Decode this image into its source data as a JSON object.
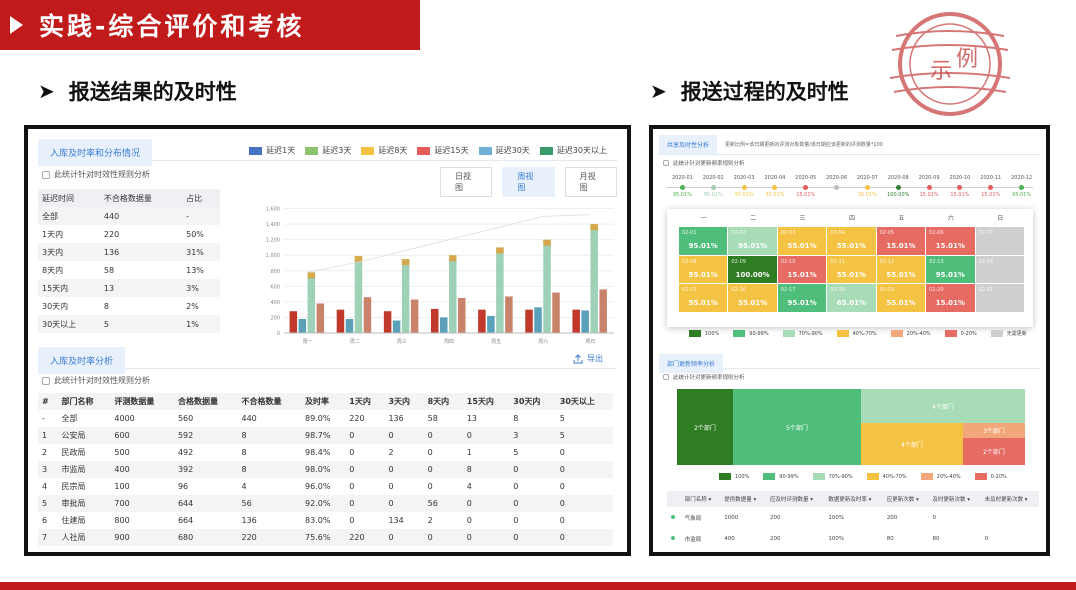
{
  "banner": {
    "title": "实践-综合评价和考核"
  },
  "left_heading": "报送结果的及时性",
  "right_heading": "报送过程的及时性",
  "stamp": {
    "text_left": "示",
    "text_right": "例"
  },
  "colors": {
    "accent_red": "#c11a1a",
    "link_blue": "#3a7bd5"
  },
  "left_panel": {
    "tab1": "入库及时率和分布情况",
    "checkbox1": "此统计针对时效性规则分析",
    "views": [
      "日视图",
      "周视图",
      "月视图"
    ],
    "legend": [
      {
        "label": "延迟1天",
        "color": "#4472c4"
      },
      {
        "label": "延迟3天",
        "color": "#8dc26f"
      },
      {
        "label": "延迟8天",
        "color": "#f5c343"
      },
      {
        "label": "延迟15天",
        "color": "#e45c5c"
      },
      {
        "label": "延迟30天",
        "color": "#6fb1d6"
      },
      {
        "label": "延迟30天以上",
        "color": "#3a9b6b"
      }
    ],
    "dist_table": {
      "headers": [
        "延迟时间",
        "不合格数据量",
        "占比"
      ],
      "rows": [
        [
          "全部",
          "440",
          "-"
        ],
        [
          "1天内",
          "220",
          "50%"
        ],
        [
          "3天内",
          "136",
          "31%"
        ],
        [
          "8天内",
          "58",
          "13%"
        ],
        [
          "15天内",
          "13",
          "3%"
        ],
        [
          "30天内",
          "8",
          "2%"
        ],
        [
          "30天以上",
          "5",
          "1%"
        ]
      ]
    },
    "tab2": "入库及时率分析",
    "export": "导出",
    "checkbox2": "此统计针对时效性规则分析",
    "dept_table": {
      "headers": [
        "#",
        "部门名称",
        "评测数据量",
        "合格数据量",
        "不合格数量",
        "及时率",
        "1天内",
        "3天内",
        "8天内",
        "15天内",
        "30天内",
        "30天以上"
      ],
      "rows": [
        [
          "-",
          "全部",
          "4000",
          "560",
          "440",
          "89.0%",
          "220",
          "136",
          "58",
          "13",
          "8",
          "5"
        ],
        [
          "1",
          "公安局",
          "600",
          "592",
          "8",
          "98.7%",
          "0",
          "0",
          "0",
          "0",
          "3",
          "5"
        ],
        [
          "2",
          "民政局",
          "500",
          "492",
          "8",
          "98.4%",
          "0",
          "2",
          "0",
          "1",
          "5",
          "0"
        ],
        [
          "3",
          "市监局",
          "400",
          "392",
          "8",
          "98.0%",
          "0",
          "0",
          "0",
          "8",
          "0",
          "0"
        ],
        [
          "4",
          "民宗局",
          "100",
          "96",
          "4",
          "96.0%",
          "0",
          "0",
          "0",
          "4",
          "0",
          "0"
        ],
        [
          "5",
          "审批局",
          "700",
          "644",
          "56",
          "92.0%",
          "0",
          "0",
          "56",
          "0",
          "0",
          "0"
        ],
        [
          "6",
          "住建局",
          "800",
          "664",
          "136",
          "83.0%",
          "0",
          "134",
          "2",
          "0",
          "0",
          "0"
        ],
        [
          "7",
          "人社局",
          "900",
          "680",
          "220",
          "75.6%",
          "220",
          "0",
          "0",
          "0",
          "0",
          "0"
        ]
      ]
    }
  },
  "chart_data": {
    "type": "bar",
    "categories": [
      "周一",
      "周二",
      "周三",
      "周四",
      "周五",
      "周六",
      "周日"
    ],
    "ylim": [
      0,
      1800
    ],
    "yticks": [
      "0",
      "200",
      "400",
      "600",
      "800",
      "1,000",
      "1,200",
      "1,400",
      "1,600"
    ],
    "series": [
      {
        "values": [
          280,
          300,
          280,
          310,
          300,
          300,
          300
        ],
        "color": "#c0392b"
      },
      {
        "values": [
          180,
          180,
          160,
          200,
          220,
          330,
          290
        ],
        "color": "#5aa0b8"
      },
      {
        "values": [
          780,
          990,
          950,
          1000,
          1100,
          1200,
          1400
        ],
        "color": "#9fd1b7"
      },
      {
        "values": [
          380,
          460,
          430,
          450,
          470,
          520,
          560
        ],
        "color": "#c8836a"
      }
    ],
    "trend": [
      780,
      900,
      1050,
      1200,
      1350,
      1500,
      1520
    ]
  },
  "right_panel": {
    "tab1": "共享及时性分析",
    "tab1_desc": "更新比例=该日期更新的评测对象数量/该日期应该更新的评测数量*100",
    "checkbox1": "此统计针对更新频率规则分析",
    "timeline": [
      {
        "m": "2020-01",
        "v": "95.01%",
        "c": "#4caf50"
      },
      {
        "m": "2020-02",
        "v": "95.01%",
        "c": "#9fcfb0"
      },
      {
        "m": "2020-03",
        "v": "35.01%",
        "c": "#f5c343"
      },
      {
        "m": "2020-04",
        "v": "35.01%",
        "c": "#f5c343"
      },
      {
        "m": "2020-05",
        "v": "15.01%",
        "c": "#e45c5c"
      },
      {
        "m": "2020-06",
        "v": "",
        "c": "#bbb"
      },
      {
        "m": "2020-07",
        "v": "35.01%",
        "c": "#f5c343"
      },
      {
        "m": "2020-08",
        "v": "100.00%",
        "c": "#2e7d32"
      },
      {
        "m": "2020-09",
        "v": "15.01%",
        "c": "#e45c5c"
      },
      {
        "m": "2020-10",
        "v": "15.01%",
        "c": "#e45c5c"
      },
      {
        "m": "2020-11",
        "v": "15.01%",
        "c": "#e45c5c"
      },
      {
        "m": "2020-12",
        "v": "95.01%",
        "c": "#4caf50"
      }
    ],
    "weekdays": [
      "一",
      "二",
      "三",
      "四",
      "五",
      "六",
      "日"
    ],
    "calendar": [
      [
        {
          "d": "02-01",
          "p": "95.01%",
          "c": "#4fbe7a"
        },
        {
          "d": "02-02",
          "p": "95.01%",
          "c": "#a8dcb7"
        },
        {
          "d": "02-03",
          "p": "55.01%",
          "c": "#f5c343"
        },
        {
          "d": "02-04",
          "p": "55.01%",
          "c": "#f5c343"
        },
        {
          "d": "02-05",
          "p": "15.01%",
          "c": "#e66b62"
        },
        {
          "d": "02-06",
          "p": "15.01%",
          "c": "#e66b62"
        },
        {
          "d": "02-07",
          "p": "",
          "c": "#cfcfcf"
        }
      ],
      [
        {
          "d": "02-08",
          "p": "55.01%",
          "c": "#f5c343"
        },
        {
          "d": "02-09",
          "p": "100.00%",
          "c": "#2e7d22"
        },
        {
          "d": "02-10",
          "p": "15.01%",
          "c": "#e66b62"
        },
        {
          "d": "02-11",
          "p": "55.01%",
          "c": "#f5c343"
        },
        {
          "d": "02-12",
          "p": "55.01%",
          "c": "#f5c343"
        },
        {
          "d": "02-13",
          "p": "95.01%",
          "c": "#4fbe7a"
        },
        {
          "d": "02-14",
          "p": "",
          "c": "#cfcfcf"
        }
      ],
      [
        {
          "d": "02-15",
          "p": "55.01%",
          "c": "#f5c343"
        },
        {
          "d": "02-16",
          "p": "55.01%",
          "c": "#f5c343"
        },
        {
          "d": "02-17",
          "p": "95.01%",
          "c": "#4fbe7a"
        },
        {
          "d": "02-18",
          "p": "65.01%",
          "c": "#a8dcb7"
        },
        {
          "d": "02-19",
          "p": "55.01%",
          "c": "#f5c343"
        },
        {
          "d": "02-20",
          "p": "15.01%",
          "c": "#e66b62"
        },
        {
          "d": "02-21",
          "p": "",
          "c": "#cfcfcf"
        }
      ]
    ],
    "legend1": [
      {
        "l": "100%",
        "c": "#2e7d22"
      },
      {
        "l": "90-99%",
        "c": "#4fbe7a"
      },
      {
        "l": "70%-90%",
        "c": "#a8dcb7"
      },
      {
        "l": "40%-70%",
        "c": "#f5c343"
      },
      {
        "l": "20%-40%",
        "c": "#f2a77a"
      },
      {
        "l": "0-20%",
        "c": "#e66b62"
      },
      {
        "l": "无需更新",
        "c": "#cfcfcf"
      }
    ],
    "tab2": "部门更新频率分析",
    "checkbox2": "此统计针对更新频率规则分析",
    "treemap": {
      "a": "2个部门",
      "b": "5个部门",
      "c": "4个部门",
      "d": "3个部门",
      "e": "4个部门",
      "f": "2个部门"
    },
    "legend2": [
      {
        "l": "100%",
        "c": "#2e7d22"
      },
      {
        "l": "90-99%",
        "c": "#4fbe7a"
      },
      {
        "l": "70%-90%",
        "c": "#a8dcb7"
      },
      {
        "l": "40%-70%",
        "c": "#f5c343"
      },
      {
        "l": "20%-40%",
        "c": "#f2a77a"
      },
      {
        "l": "0-20%",
        "c": "#e66b62"
      }
    ],
    "dept_headers": [
      "部门名称",
      "提供数据量",
      "应及时评测数量",
      "数据更新及时率",
      "应更新次数",
      "及时更新次数",
      "未及时更新次数"
    ],
    "dept_rows": [
      {
        "dot": "#4fbe7a",
        "cells": [
          "气象局",
          "1000",
          "200",
          "100%",
          "200",
          "0"
        ]
      },
      {
        "dot": "#4fbe7a",
        "cells": [
          "市监局",
          "400",
          "200",
          "100%",
          "80",
          "80",
          "0"
        ]
      }
    ]
  }
}
